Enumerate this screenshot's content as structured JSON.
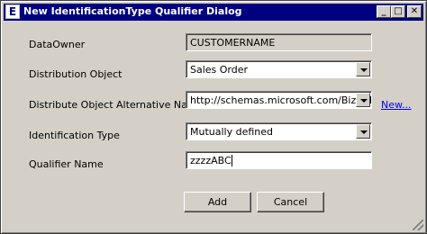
{
  "window": {
    "title": "New IdentificationType Qualifier Dialog",
    "app_icon_glyph": "E",
    "minimize_glyph": "_",
    "maximize_glyph": "□",
    "close_glyph": "✕"
  },
  "form": {
    "data_owner": {
      "label": "DataOwner",
      "value": "CUSTOMERNAME"
    },
    "distribution_object": {
      "label": "Distribution Object",
      "value": "Sales Order"
    },
    "alternative_name": {
      "label": "Distribute Object Alternative Name",
      "value": "http://schemas.microsoft.com/BizTalk/",
      "link": "New..."
    },
    "identification_type": {
      "label": "Identification Type",
      "value": "Mutually defined"
    },
    "qualifier_name": {
      "label": "Qualifier Name",
      "value": "zzzzABC"
    }
  },
  "buttons": {
    "add": "Add",
    "cancel": "Cancel"
  },
  "icons": [
    "app-icon",
    "minimize-icon",
    "maximize-icon",
    "close-icon",
    "chevron-down-icon",
    "resize-grip-icon"
  ],
  "colors": {
    "titlebar": "#000080",
    "face": "#d4d0c8",
    "link": "#0000ff"
  }
}
